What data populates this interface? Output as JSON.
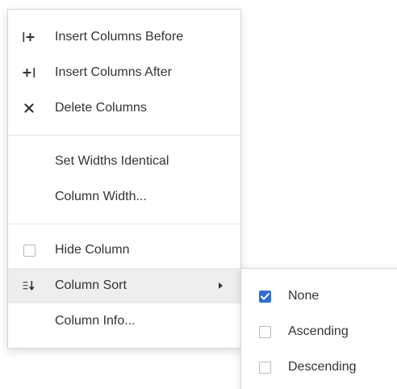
{
  "menu": {
    "items": [
      {
        "label": "Insert Columns Before",
        "icon": "insert-before-icon"
      },
      {
        "label": "Insert Columns After",
        "icon": "insert-after-icon"
      },
      {
        "label": "Delete Columns",
        "icon": "close-icon"
      },
      {
        "label": "Set Widths Identical",
        "icon": ""
      },
      {
        "label": "Column Width...",
        "icon": ""
      },
      {
        "label": "Hide Column",
        "icon": "checkbox-unchecked-icon",
        "checked": false
      },
      {
        "label": "Column Sort",
        "icon": "sort-icon",
        "has_submenu": true,
        "highlighted": true
      },
      {
        "label": "Column Info...",
        "icon": ""
      }
    ]
  },
  "submenu": {
    "items": [
      {
        "label": "None",
        "checked": true
      },
      {
        "label": "Ascending",
        "checked": false
      },
      {
        "label": "Descending",
        "checked": false
      }
    ]
  },
  "colors": {
    "checkbox_checked": "#2f6fd4",
    "hover_background": "#eeeeee",
    "text": "#333333"
  }
}
